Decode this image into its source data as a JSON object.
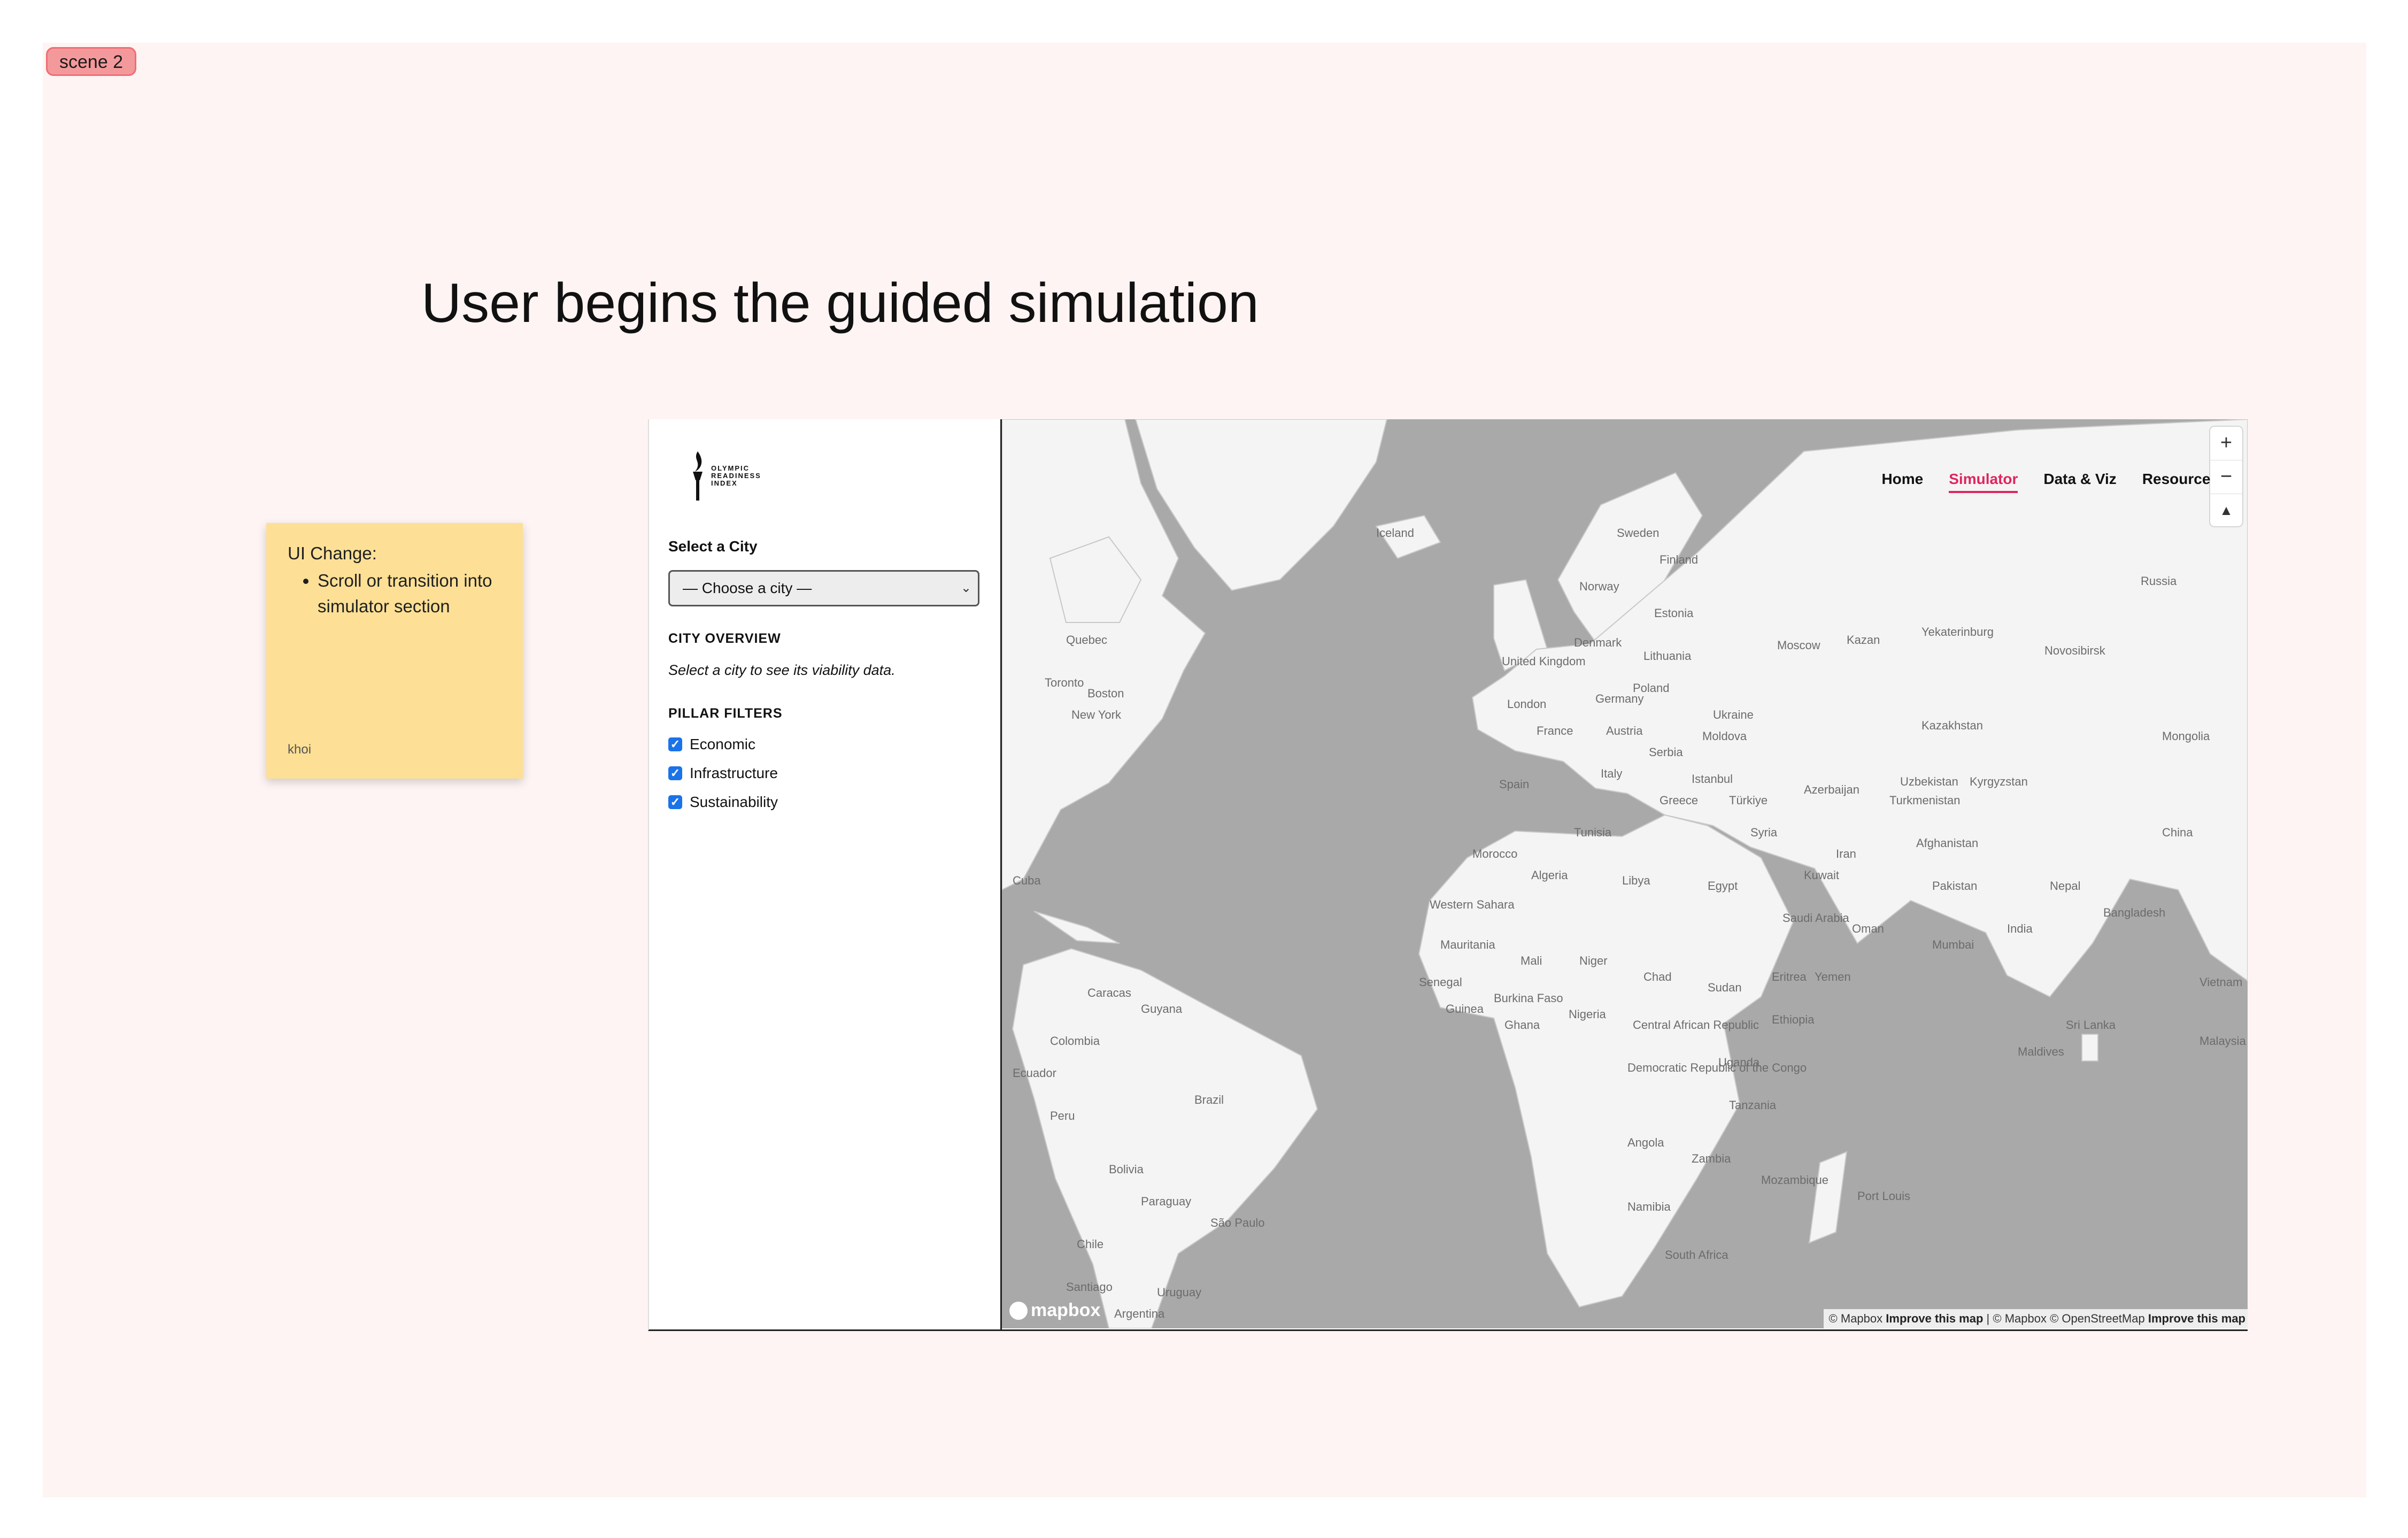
{
  "scene": {
    "tag": "scene 2",
    "headline": "User begins the guided simulation"
  },
  "sticky": {
    "title": "UI Change:",
    "bullets": [
      "Scroll or transition into simulator section"
    ],
    "author": "khoi"
  },
  "app": {
    "logo_lines": [
      "OLYMPIC",
      "READINESS",
      "INDEX"
    ],
    "select_city_label": "Select a City",
    "select_value": "— Choose a city —",
    "city_overview_title": "CITY OVERVIEW",
    "city_overview_hint": "Select a city to see its viability data.",
    "pillar_filters_title": "PILLAR FILTERS",
    "filters": [
      "Economic",
      "Infrastructure",
      "Sustainability"
    ]
  },
  "nav": {
    "items": [
      "Home",
      "Simulator",
      "Data & Viz",
      "Resources"
    ],
    "active": "Simulator"
  },
  "map": {
    "zoom_in": "+",
    "zoom_out": "−",
    "compass": "▲",
    "attribution_prefix": "© Mapbox",
    "attribution_improve": "Improve this map",
    "attribution_mid": "| © Mapbox © OpenStreetMap",
    "attribution_improve2": "Improve this map",
    "logo": "mapbox",
    "labels": [
      "Iceland",
      "Sweden",
      "Finland",
      "Norway",
      "Russia",
      "Estonia",
      "Moscow",
      "Kazan",
      "Yekaterinburg",
      "Novosibirsk",
      "Denmark",
      "Lithuania",
      "United Kingdom",
      "London",
      "Poland",
      "Germany",
      "Ukraine",
      "France",
      "Kazakhstan",
      "Mongolia",
      "Austria",
      "Serbia",
      "Moldova",
      "Italy",
      "Spain",
      "Istanbul",
      "Türkiye",
      "Greece",
      "Uzbekistan",
      "Kyrgyzstan",
      "Azerbaijan",
      "Turkmenistan",
      "Syria",
      "China",
      "Tunisia",
      "Morocco",
      "Iran",
      "Afghanistan",
      "Algeria",
      "Libya",
      "Egypt",
      "Kuwait",
      "Pakistan",
      "Nepal",
      "Western Sahara",
      "Saudi Arabia",
      "Bangladesh",
      "Oman",
      "Mauritania",
      "Mumbai",
      "India",
      "Mali",
      "Niger",
      "Chad",
      "Sudan",
      "Eritrea",
      "Yemen",
      "Vietnam",
      "Senegal",
      "Guinea",
      "Burkina Faso",
      "Ghana",
      "Nigeria",
      "Central African Republic",
      "Ethiopia",
      "Sri Lanka",
      "Malaysia",
      "Maldives",
      "Democratic Republic of the Congo",
      "Uganda",
      "Tanzania",
      "Angola",
      "Zambia",
      "Mozambique",
      "Namibia",
      "Port Louis",
      "South Africa",
      "Quebec",
      "Toronto",
      "Boston",
      "New York",
      "Cuba",
      "Caracas",
      "Guyana",
      "Colombia",
      "Ecuador",
      "Brazil",
      "Peru",
      "Bolivia",
      "Paraguay",
      "São Paulo",
      "Chile",
      "Santiago",
      "Uruguay",
      "Argentina"
    ]
  }
}
